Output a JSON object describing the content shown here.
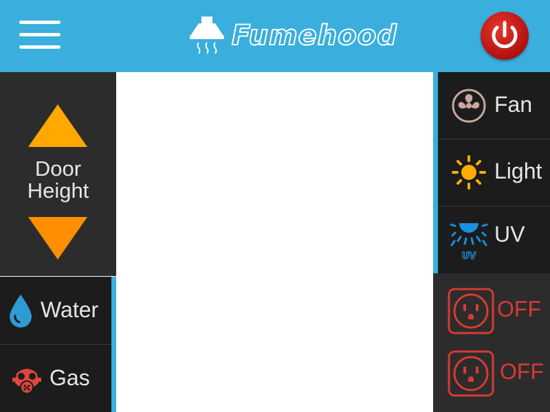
{
  "header": {
    "brand": "Fumehood"
  },
  "door": {
    "label_line1": "Door",
    "label_line2": "Height"
  },
  "left_items": {
    "water": "Water",
    "gas": "Gas"
  },
  "right_items": {
    "fan": "Fan",
    "light": "Light",
    "uv": "UV",
    "uv_icon_text": "UV"
  },
  "outlets": [
    {
      "state": "OFF"
    },
    {
      "state": "OFF"
    }
  ],
  "colors": {
    "header": "#3aaedc",
    "accent": "#3aaedc",
    "power": "#cc1b14",
    "arrow_up": "#ffa800",
    "arrow_down": "#ff8f00",
    "outlet": "#d93a33",
    "light_icon": "#ffae00",
    "uv_icon": "#1b8fe0"
  }
}
